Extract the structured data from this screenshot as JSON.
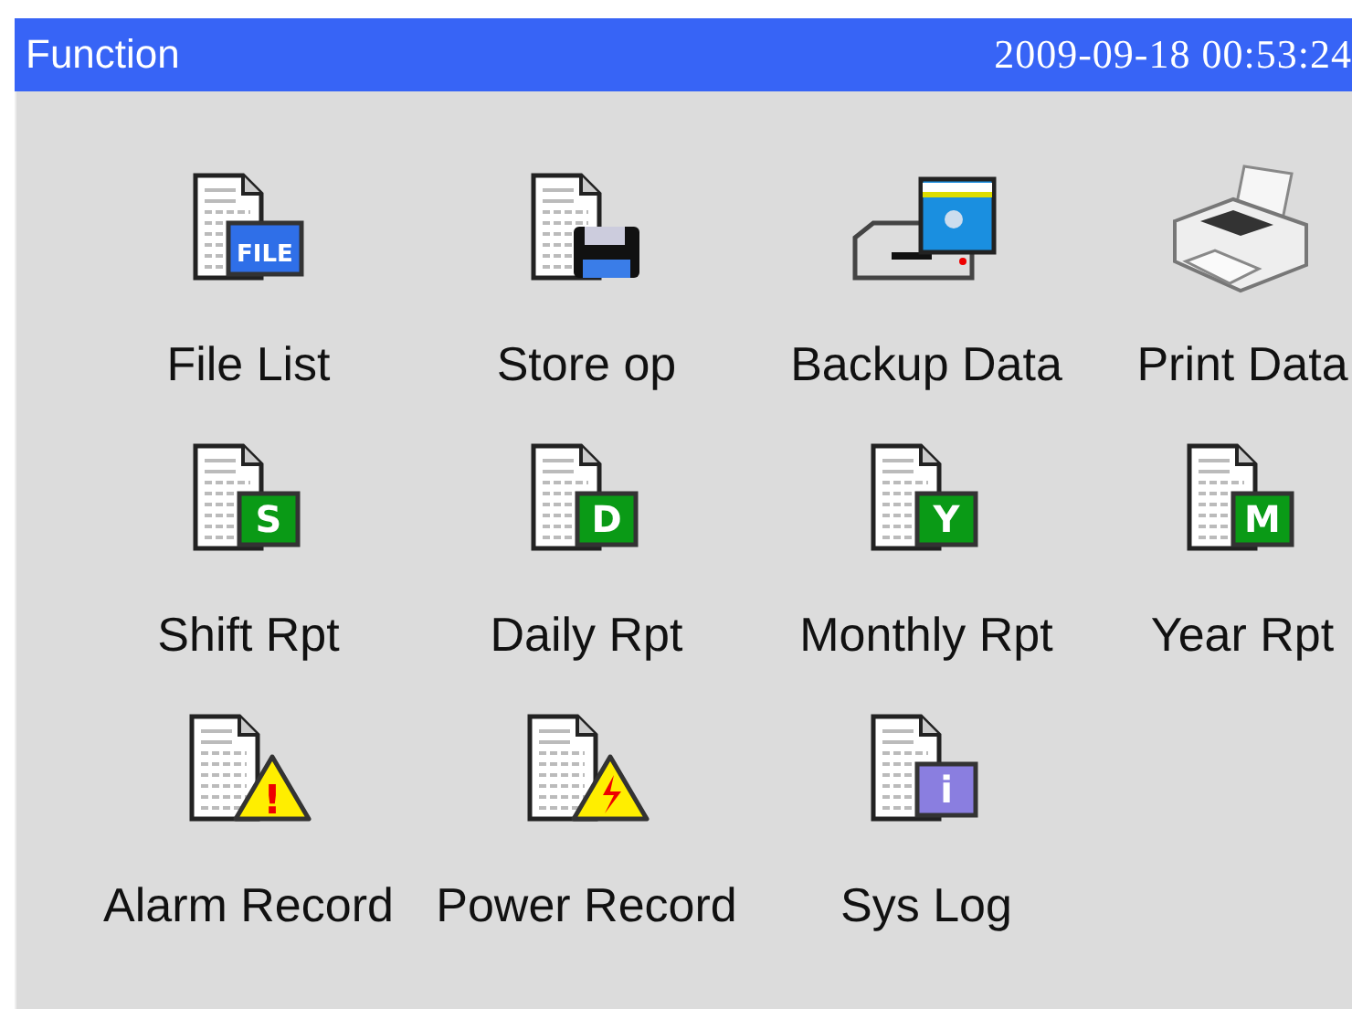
{
  "header": {
    "title": "Function",
    "datetime": "2009-09-18 00:53:24"
  },
  "items": [
    {
      "label": "File List",
      "kind": "badge",
      "badge": "FILE",
      "color": "#2f6fe8"
    },
    {
      "label": "Store op",
      "kind": "floppy"
    },
    {
      "label": "Backup Data",
      "kind": "drive"
    },
    {
      "label": "Print Data",
      "kind": "printer"
    },
    {
      "label": "Shift Rpt",
      "kind": "badge",
      "badge": "S",
      "color": "#0a9a16"
    },
    {
      "label": "Daily Rpt",
      "kind": "badge",
      "badge": "D",
      "color": "#0a9a16"
    },
    {
      "label": "Monthly Rpt",
      "kind": "badge",
      "badge": "Y",
      "color": "#0a9a16"
    },
    {
      "label": "Year Rpt",
      "kind": "badge",
      "badge": "M",
      "color": "#0a9a16"
    },
    {
      "label": "Alarm Record",
      "kind": "alarm",
      "badge": "!"
    },
    {
      "label": "Power Record",
      "kind": "power"
    },
    {
      "label": "Sys Log",
      "kind": "badge",
      "badge": "i",
      "color": "#8a7ee0"
    }
  ]
}
